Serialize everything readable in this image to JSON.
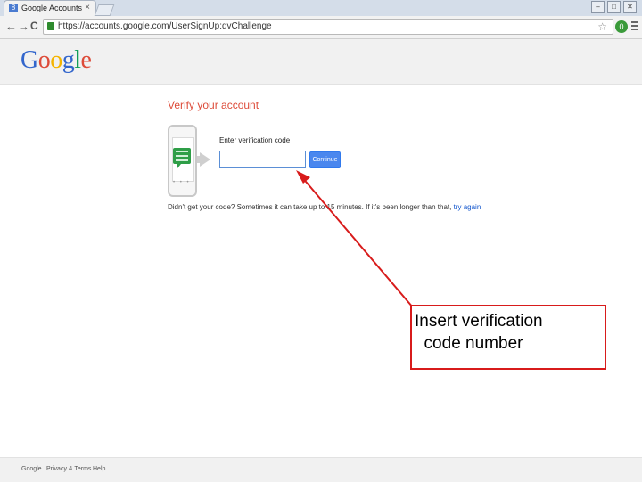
{
  "browser": {
    "tab_title": "Google Accounts",
    "tab_close": "×",
    "url": "https://accounts.google.com/UserSignUp:dvChallenge",
    "back_glyph": "←",
    "forward_glyph": "→",
    "reload_glyph": "C",
    "star_glyph": "☆",
    "window_buttons": [
      "–",
      "□",
      "✕"
    ],
    "extension_badge": "0"
  },
  "header": {
    "logo_letters": [
      {
        "ch": "G",
        "color": "#3366cc"
      },
      {
        "ch": "o",
        "color": "#dd4b39"
      },
      {
        "ch": "o",
        "color": "#f4b400"
      },
      {
        "ch": "g",
        "color": "#3366cc"
      },
      {
        "ch": "l",
        "color": "#109d58"
      },
      {
        "ch": "e",
        "color": "#dd4b39"
      }
    ]
  },
  "main": {
    "title": "Verify your account",
    "code_label": "Enter verification code",
    "code_input_value": "",
    "continue_label": "Continue",
    "help_text": "Didn't get your code? Sometimes it can take up to 15 minutes. If it's been longer than that, ",
    "help_link": "try again"
  },
  "annotation": {
    "text": "Insert verification\n  code number",
    "color": "#d81b1b"
  },
  "footer": {
    "links": [
      "Google",
      "Privacy & Terms",
      "Help"
    ]
  }
}
